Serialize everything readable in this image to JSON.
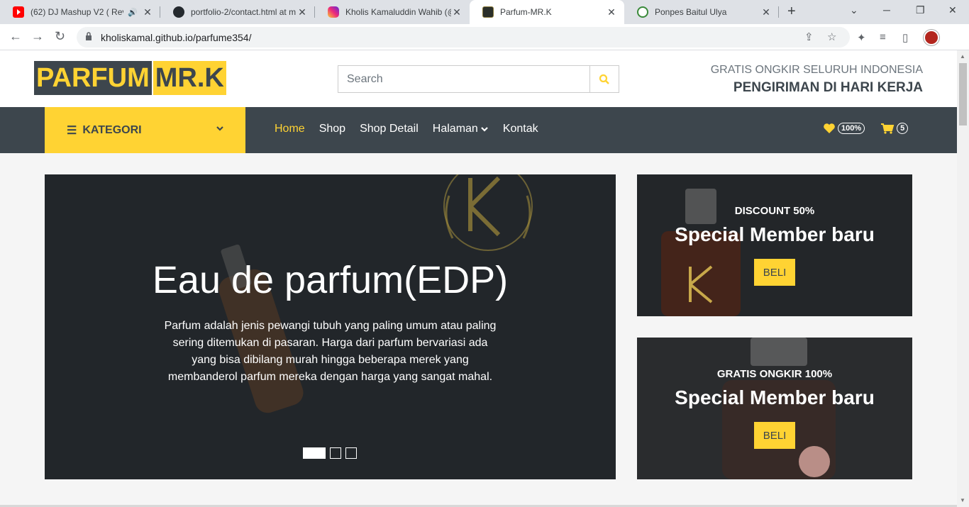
{
  "browser": {
    "tabs": [
      {
        "title": "(62) DJ Mashup V2 ( Reve",
        "active": false
      },
      {
        "title": "portfolio-2/contact.html at m",
        "active": false
      },
      {
        "title": "Kholis Kamaluddin Wahib (@",
        "active": false
      },
      {
        "title": "Parfum-MR.K",
        "active": true
      },
      {
        "title": "Ponpes Baitul Ulya",
        "active": false
      }
    ],
    "url": "kholiskamal.github.io/parfume354/"
  },
  "header": {
    "logo_part1": "PARFUM",
    "logo_part2": "MR.K",
    "search_placeholder": "Search",
    "promo_line1": "GRATIS ONGKIR SELURUH INDONESIA",
    "promo_line2": "PENGIRIMAN DI HARI KERJA"
  },
  "nav": {
    "category_label": "KATEGORI",
    "links": [
      "Home",
      "Shop",
      "Shop Detail",
      "Halaman",
      "Kontak"
    ],
    "wishlist_count": "100%",
    "cart_count": "5"
  },
  "hero": {
    "title": "Eau de parfum(EDP)",
    "text": "Parfum adalah jenis pewangi tubuh yang paling umum atau paling sering ditemukan di pasaran. Harga dari parfum bervariasi ada yang bisa dibilang murah hingga beberapa merek yang membanderol parfum mereka dengan harga yang sangat mahal.",
    "slide_count": 3,
    "active_slide": 1
  },
  "offers": [
    {
      "tag": "DISCOUNT 50%",
      "title": "Special Member baru",
      "button": "BELI"
    },
    {
      "tag": "GRATIS ONGKIR 100%",
      "title": "Special Member baru",
      "button": "BELI"
    }
  ],
  "colors": {
    "accent": "#ffd333",
    "dark": "#3d464d"
  }
}
